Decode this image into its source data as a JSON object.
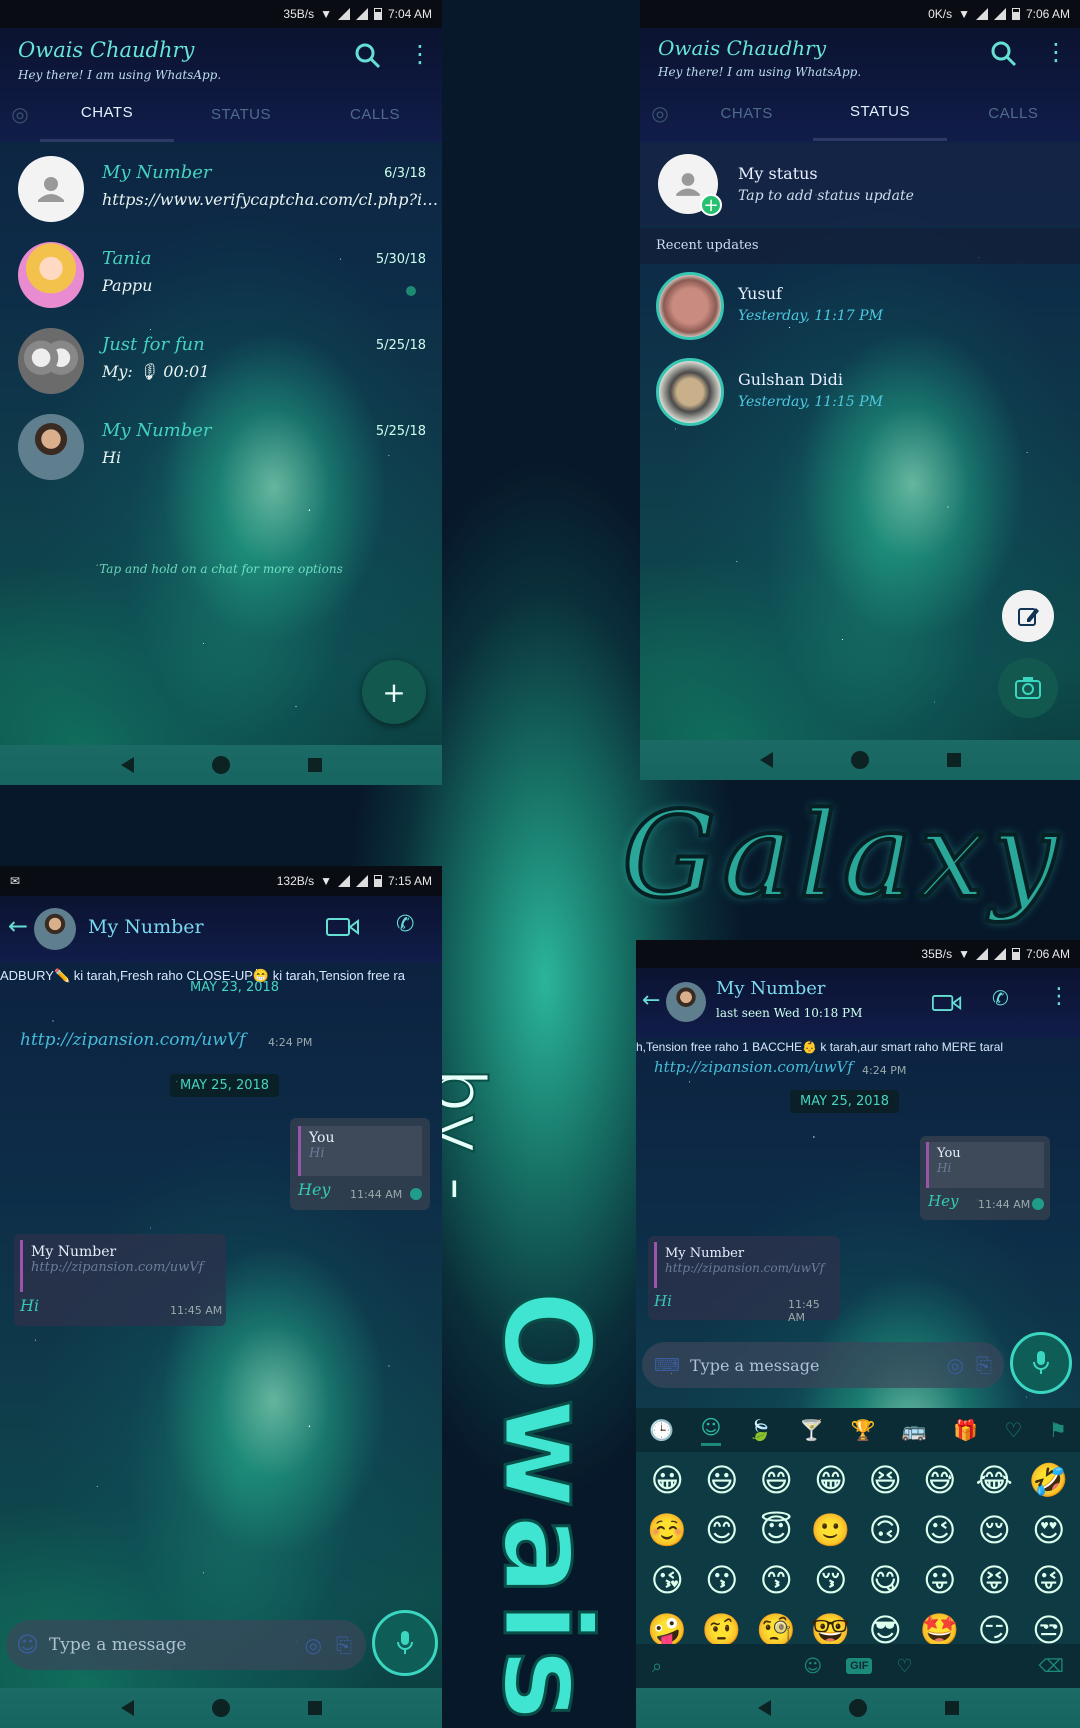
{
  "brand": {
    "galaxy": "Galaxy",
    "by": "by -",
    "owais": "Owais"
  },
  "panel1": {
    "status": {
      "speed": "35B/s",
      "time": "7:04 AM"
    },
    "title": "Owais Chaudhry",
    "subtitle": "Hey there! I am using WhatsApp.",
    "tabs": [
      "CHATS",
      "STATUS",
      "CALLS"
    ],
    "chats": [
      {
        "name": "My Number",
        "message": "https://www.verifycaptcha.com/cl.php?id=...",
        "date": "6/3/18"
      },
      {
        "name": "Tania",
        "message": "Pappu",
        "date": "5/30/18"
      },
      {
        "name": "Just for fun",
        "message": "My: 🎙 00:01",
        "date": "5/25/18"
      },
      {
        "name": "My Number",
        "message": "Hi",
        "date": "5/25/18"
      }
    ],
    "hint": "Tap and hold on a chat for more options",
    "fab": "+"
  },
  "panel2": {
    "status": {
      "speed": "0K/s",
      "time": "7:06 AM"
    },
    "title": "Owais Chaudhry",
    "subtitle": "Hey there! I am using WhatsApp.",
    "tabs": [
      "CHATS",
      "STATUS",
      "CALLS"
    ],
    "my_status": {
      "title": "My status",
      "subtitle": "Tap to add status update"
    },
    "recent_label": "Recent updates",
    "updates": [
      {
        "name": "Yusuf",
        "time": "Yesterday, 11:17 PM"
      },
      {
        "name": "Gulshan Didi",
        "time": "Yesterday, 11:15 PM"
      }
    ]
  },
  "panel3": {
    "status": {
      "speed": "132B/s",
      "time": "7:15 AM"
    },
    "contact": "My Number",
    "ticker": "ADBURY✏️ ki tarah,Fresh raho CLOSE-UP😁 ki tarah,Tension free ra",
    "date_top": "MAY 23, 2018",
    "link": "http://zipansion.com/uwVf",
    "link_time": "4:24 PM",
    "date_chip": "MAY 25, 2018",
    "out_msg": {
      "quote_name": "You",
      "quote_text": "Hi",
      "text": "Hey",
      "time": "11:44 AM"
    },
    "in_msg": {
      "quote_name": "My Number",
      "quote_text": "http://zipansion.com/uwVf",
      "text": "Hi",
      "time": "11:45 AM"
    },
    "input_placeholder": "Type a message"
  },
  "panel4": {
    "status": {
      "speed": "35B/s",
      "time": "7:06 AM"
    },
    "contact": "My Number",
    "last_seen": "last seen Wed 10:18 PM",
    "ticker": "h,Tension free raho 1 BACCHE👶 k tarah,aur smart raho MERE taral",
    "link": "http://zipansion.com/uwVf",
    "link_time": "4:24 PM",
    "date_chip": "MAY 25, 2018",
    "out_msg": {
      "quote_name": "You",
      "quote_text": "Hi",
      "text": "Hey",
      "time": "11:44 AM"
    },
    "in_msg": {
      "quote_name": "My Number",
      "quote_text": "http://zipansion.com/uwVf",
      "text": "Hi",
      "time": "11:45 AM"
    },
    "input_placeholder": "Type a message",
    "emoji_categories": [
      "🕒",
      "☺",
      "🍃",
      "🍸",
      "🏆",
      "🚌",
      "🎁",
      "♡",
      "⚑"
    ],
    "emojis": [
      "😀",
      "😃",
      "😄",
      "😁",
      "😆",
      "😅",
      "😂",
      "🤣",
      "☺️",
      "😊",
      "😇",
      "🙂",
      "🙃",
      "😉",
      "😌",
      "😍",
      "😘",
      "😗",
      "😙",
      "😚",
      "😋",
      "😛",
      "😝",
      "😜",
      "🤪",
      "🤨",
      "🧐",
      "🤓",
      "😎",
      "🤩",
      "😏",
      "😒"
    ],
    "kb_bottom": {
      "gif": "GIF"
    }
  }
}
